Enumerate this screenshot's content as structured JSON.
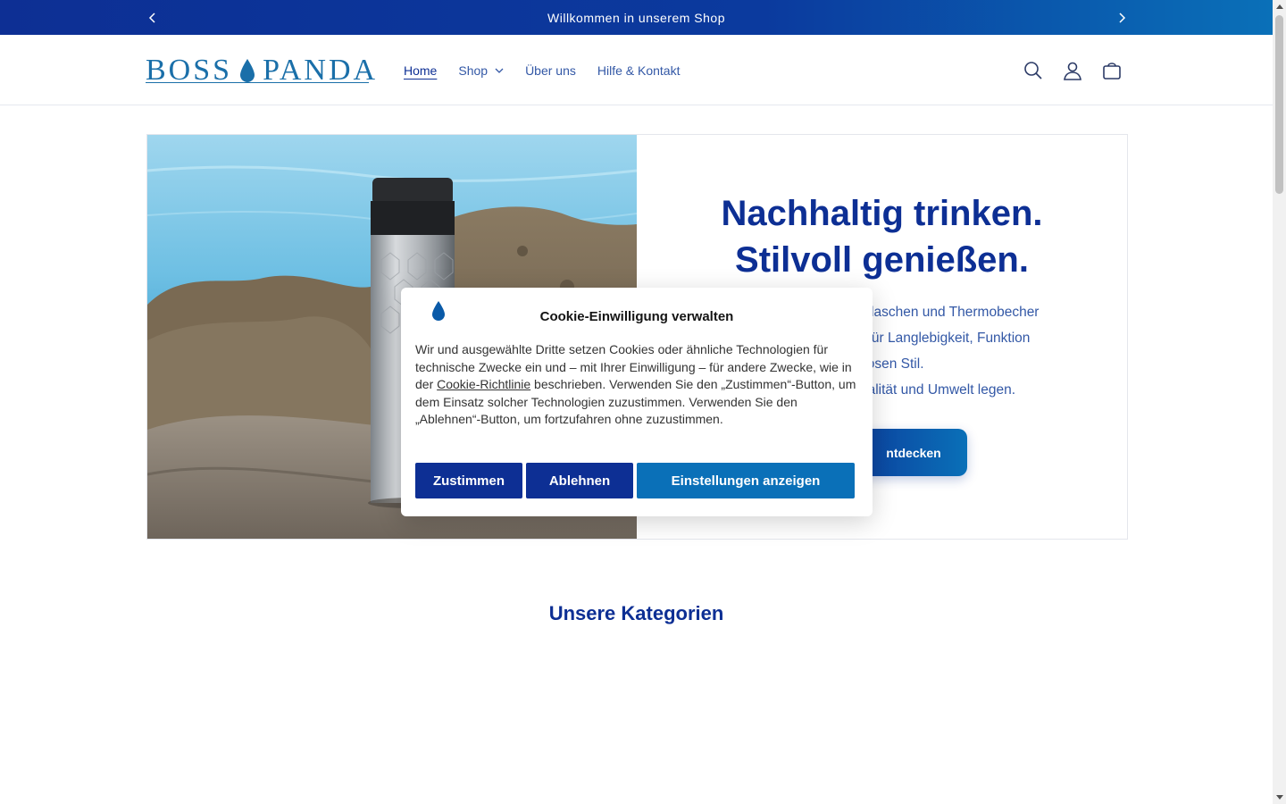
{
  "announcement": {
    "text": "Willkommen in unserem Shop"
  },
  "header": {
    "logo_left": "BOSS",
    "logo_right": "PANDA",
    "nav": [
      {
        "label": "Home",
        "active": true
      },
      {
        "label": "Shop",
        "has_dropdown": true
      },
      {
        "label": "Über uns"
      },
      {
        "label": "Hilfe & Kontakt"
      }
    ],
    "icons": [
      "search-icon",
      "account-icon",
      "cart-icon"
    ]
  },
  "hero": {
    "title_line1": "Nachhaltig trinken.",
    "title_line2": "Stilvoll genießen.",
    "desc_lines": [
      "kflaschen und Thermobecher",
      "t für Langlebigkeit, Funktion",
      "tlosen Stil.",
      "ualität und Umwelt legen."
    ],
    "cta_label": "ntdecken"
  },
  "sections": {
    "categories_title": "Unsere Kategorien"
  },
  "cookie": {
    "title": "Cookie-Einwilligung verwalten",
    "body_before_link": "Wir und ausgewählte Dritte setzen Cookies oder ähnliche Technologien für technische Zwecke ein und – mit Ihrer Einwilligung – für andere Zwecke, wie in der ",
    "link": "Cookie-Richtlinie",
    "body_after_link": " beschrieben. Verwenden Sie den „Zustimmen“-Button, um dem Einsatz solcher Technologien zuzustimmen. Verwenden Sie den „Ablehnen“-Button, um fortzufahren ohne zuzustimmen.",
    "accept_label": "Zustimmen",
    "deny_label": "Ablehnen",
    "settings_label": "Einstellungen anzeigen"
  },
  "colors": {
    "brand": "#0d2f94",
    "accent": "#0a70b8",
    "logo": "#1a6fa9"
  }
}
